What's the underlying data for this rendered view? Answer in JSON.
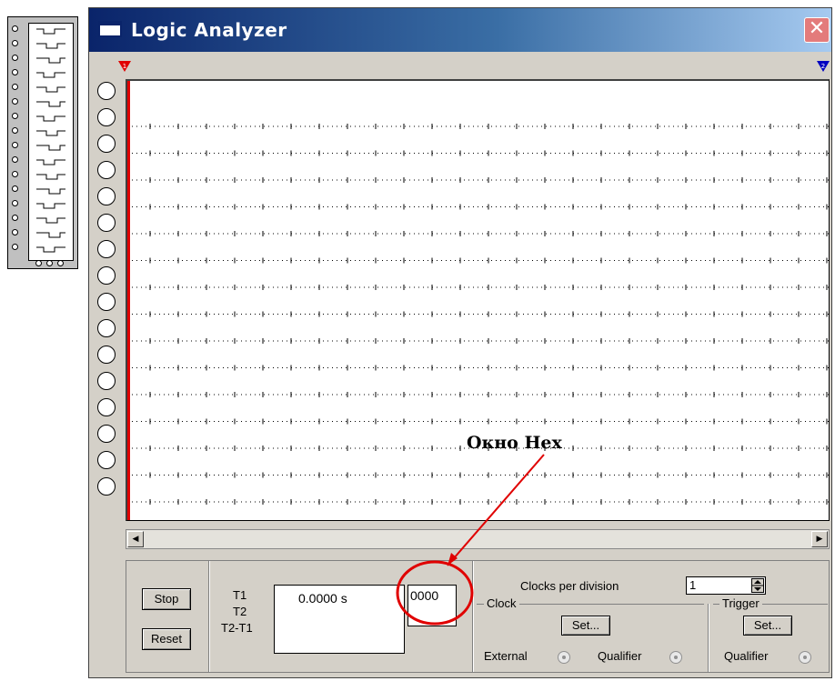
{
  "window": {
    "title": "Logic Analyzer",
    "close_glyph": "✕",
    "title_icon": "window-icon",
    "colors": {
      "title_start": "#0a246a",
      "title_end": "#a6caf0",
      "trace_start": "#e00000",
      "annotation": "#e00000"
    }
  },
  "markers": {
    "t1": "1",
    "t2": "2"
  },
  "channels": {
    "count": 16,
    "icon": "channel-terminal-icon"
  },
  "scroll": {
    "left_arrow": "◀",
    "right_arrow": "▶"
  },
  "controls": {
    "stop_label": "Stop",
    "reset_label": "Reset",
    "t1_label": "T1",
    "t2_label": "T2",
    "t2t1_label": "T2-T1",
    "t1_value": "0.0000  s",
    "hex_value": "0000",
    "clocks_per_division_label": "Clocks per division",
    "clocks_per_division_value": "1",
    "clock_group_label": "Clock",
    "trigger_group_label": "Trigger",
    "clock_set_label": "Set...",
    "trigger_set_label": "Set...",
    "external_label": "External",
    "clock_qualifier_label": "Qualifier",
    "trigger_qualifier_label": "Qualifier"
  },
  "annotation": {
    "text": "Окно Hex"
  }
}
